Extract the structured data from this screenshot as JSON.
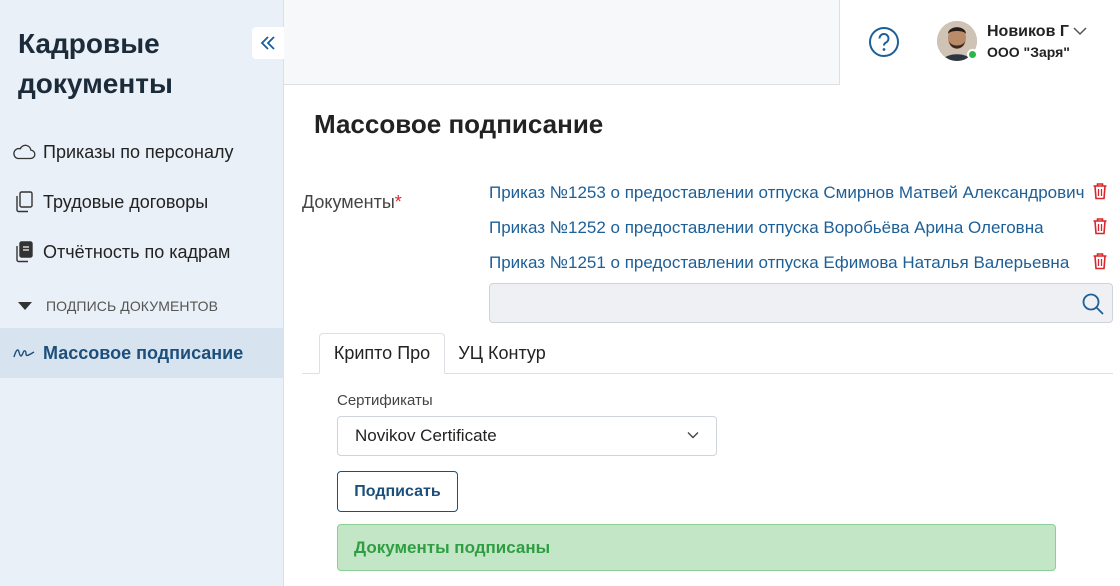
{
  "sidebar": {
    "title": "Кадровые документы",
    "items": [
      {
        "label": "Приказы по персоналу",
        "icon": "cloud-icon"
      },
      {
        "label": "Трудовые договоры",
        "icon": "documents-icon"
      },
      {
        "label": "Отчётность по кадрам",
        "icon": "documents-stack-icon"
      }
    ],
    "section_label": "ПОДПИСЬ ДОКУМЕНТОВ",
    "active_item": {
      "label": "Массовое подписание",
      "icon": "signature-icon"
    }
  },
  "header": {
    "user_name": "Новиков Г",
    "user_org": "ООО \"Заря\""
  },
  "main": {
    "title": "Массовое подписание",
    "documents_label": "Документы",
    "required_mark": "*",
    "documents": [
      "Приказ №1253 о предоставлении отпуска Смирнов Матвей Александрович",
      "Приказ №1252 о предоставлении отпуска Воробьёва Арина Олеговна",
      "Приказ №1251 о предоставлении отпуска Ефимова Наталья Валерьевна"
    ],
    "search_value": "",
    "tabs": [
      {
        "label": "Крипто Про",
        "active": true
      },
      {
        "label": "УЦ Контур",
        "active": false
      }
    ],
    "certificates_label": "Сертификаты",
    "certificate_selected": "Novikov Certificate",
    "sign_button": "Подписать",
    "success_message": "Документы подписаны"
  },
  "colors": {
    "accent": "#1d5f97",
    "sidebar_bg": "#e9f0f7",
    "danger": "#d9262c",
    "success_bg": "#c3e6c6",
    "success_text": "#2f9e43"
  }
}
